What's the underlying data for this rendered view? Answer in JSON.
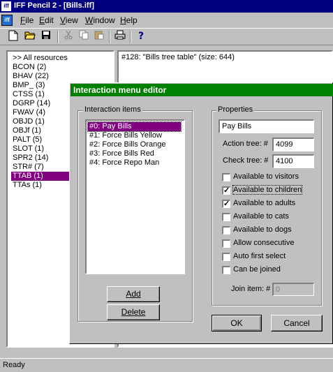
{
  "app": {
    "title": "IFF Pencil 2 - [Bills.iff]",
    "icon": "iff-app-icon"
  },
  "menu": {
    "items": [
      "File",
      "Edit",
      "View",
      "Window",
      "Help"
    ]
  },
  "toolbar": {
    "icons": [
      "new-file-icon",
      "open-folder-icon",
      "save-icon",
      "cut-icon",
      "copy-icon",
      "paste-icon",
      "print-icon",
      "help-icon"
    ]
  },
  "resources": {
    "items": [
      "BCON (2)",
      "BHAV (22)",
      "BMP_ (3)",
      "CTSS (1)",
      "DGRP (14)",
      "FWAV (4)",
      "OBJD (1)",
      "OBJf (1)",
      "PALT (5)",
      "SLOT (1)",
      "SPR2 (14)",
      "STR# (7)",
      "TTAB (1)",
      "TTAs (1)"
    ],
    "header": ">> All resources",
    "selected": "TTAB (1)"
  },
  "info": {
    "text": "#128: \"Bills tree table\" (size: 644)"
  },
  "status": {
    "text": "Ready"
  },
  "dialog": {
    "title": "Interaction menu editor",
    "interactions_label": "Interaction items",
    "interactions": [
      "#0: Pay Bills",
      "#1: Force Bills Yellow",
      "#2: Force Bills Orange",
      "#3: Force Bills Red",
      "#4: Force Repo Man"
    ],
    "selected_interaction": "#0: Pay Bills",
    "add_label": "Add",
    "delete_label": "Delete",
    "properties_label": "Properties",
    "name_value": "Pay Bills",
    "action_tree_label": "Action tree: #",
    "action_tree_value": "4099",
    "check_tree_label": "Check tree: #",
    "check_tree_value": "4100",
    "checkboxes": [
      {
        "label": "Available to visitors",
        "checked": false
      },
      {
        "label": "Available to children",
        "checked": true
      },
      {
        "label": "Available to adults",
        "checked": true
      },
      {
        "label": "Available to cats",
        "checked": false
      },
      {
        "label": "Available to dogs",
        "checked": false
      },
      {
        "label": "Allow consecutive",
        "checked": false
      },
      {
        "label": "Auto first select",
        "checked": false
      },
      {
        "label": "Can be joined",
        "checked": false
      }
    ],
    "join_label": "Join item: #",
    "join_value": "0",
    "ok_label": "OK",
    "cancel_label": "Cancel"
  },
  "colors": {
    "titlebar": "#000080",
    "dialog_titlebar": "#008000",
    "selection": "#800080"
  }
}
